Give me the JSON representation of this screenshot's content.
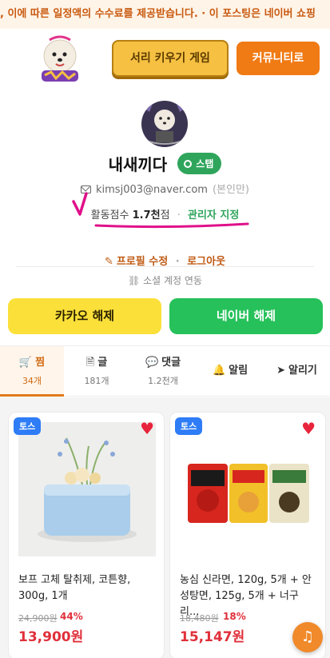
{
  "ticker": {
    "text": ", 이에 따른 일정액의 수수료를 제공받습니다.  ·  이 포스팅은 네이버 쇼핑"
  },
  "header": {
    "game_button": "서리 키우기 게임",
    "community_button": "커뮤니티로",
    "logo_icon": "dog-mascot-logo"
  },
  "profile": {
    "nickname": "내새끼다",
    "badge": "스탭",
    "email": "kimsj003@naver.com",
    "email_note": "(본인만)",
    "score_label": "활동점수",
    "score_value": "1.7천",
    "score_unit": "점",
    "separator": "·",
    "admin_link": "관리자 지정",
    "edit_profile": "프로필 수정",
    "logout": "로그아웃",
    "social_link": "소셜 계정 연동"
  },
  "auth": {
    "kakao": "카카오 해제",
    "naver": "네이버 해제"
  },
  "tabs": [
    {
      "label": "찜",
      "count": "34개",
      "icon": "cart-icon"
    },
    {
      "label": "글",
      "count": "181개",
      "icon": "document-icon"
    },
    {
      "label": "댓글",
      "count": "1.2천개",
      "icon": "comment-icon"
    },
    {
      "label": "알림",
      "icon": "bell-icon"
    },
    {
      "label": "알리기",
      "icon": "share-icon"
    }
  ],
  "products": [
    {
      "tag": "토스",
      "title": "보프 고체 탈취제, 코튼향, 300g, 1개",
      "old_price": "24,900원",
      "discount": "44%",
      "price": "13,900원"
    },
    {
      "tag": "토스",
      "title": "농심 신라면, 120g, 5개 + 안성탕면, 125g, 5개 + 너구리...",
      "old_price": "18,480원",
      "discount": "18%",
      "price": "15,147원"
    }
  ],
  "colors": {
    "accent_orange": "#f07a14",
    "kakao_yellow": "#fbe03a",
    "naver_green": "#26c15a",
    "sale_red": "#e0303a",
    "toss_blue": "#2e7cf6"
  }
}
